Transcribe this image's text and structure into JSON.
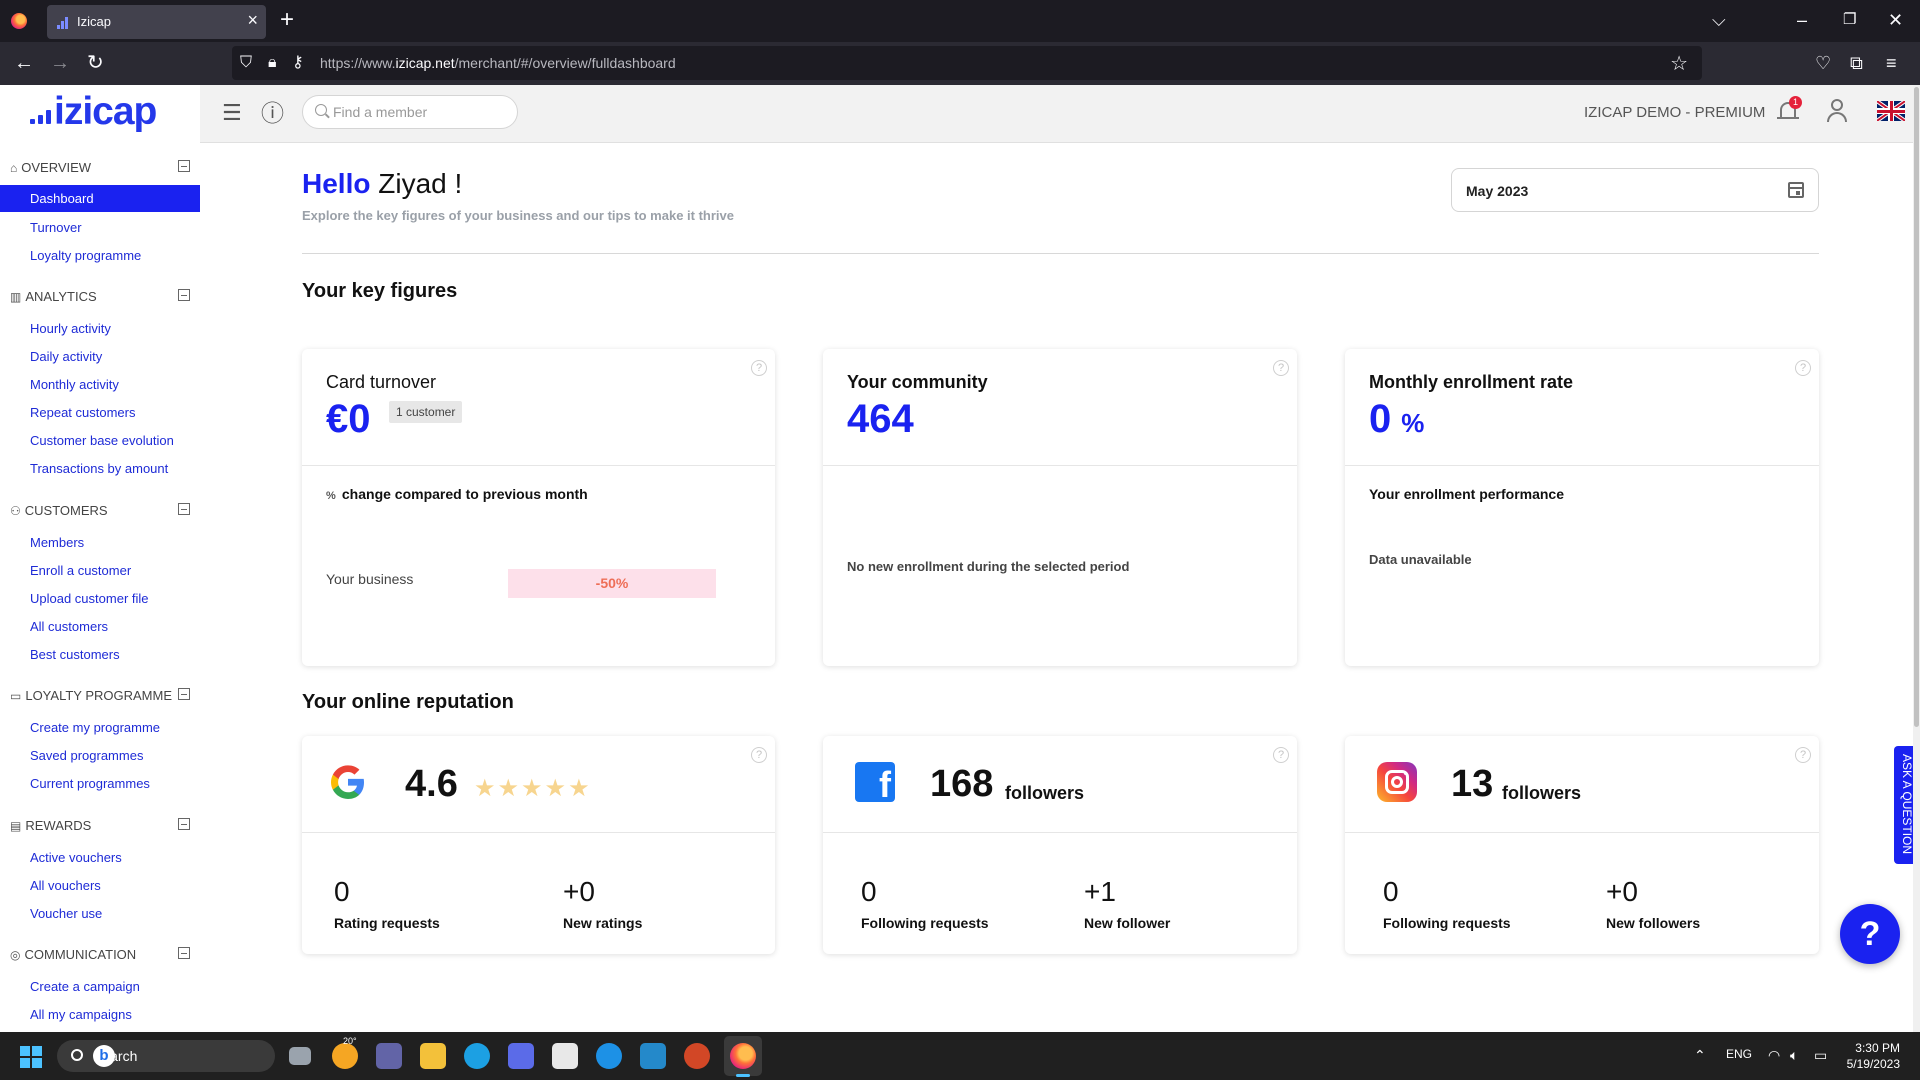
{
  "browser": {
    "tab_title": "Izicap",
    "url_prefix": "https://www.",
    "url_domain": "izicap.net",
    "url_path": "/merchant/#/overview/fulldashboard"
  },
  "header": {
    "logo_text": "izicap",
    "search_placeholder": "Find a member",
    "account_name": "IZICAP DEMO - PREMIUM",
    "notification_count": "1"
  },
  "sidebar": {
    "sections": [
      {
        "title": "OVERVIEW",
        "items": [
          "Dashboard",
          "Turnover",
          "Loyalty programme"
        ]
      },
      {
        "title": "ANALYTICS",
        "items": [
          "Hourly activity",
          "Daily activity",
          "Monthly activity",
          "Repeat customers",
          "Customer base evolution",
          "Transactions by amount"
        ]
      },
      {
        "title": "CUSTOMERS",
        "items": [
          "Members",
          "Enroll a customer",
          "Upload customer file",
          "All customers",
          "Best customers"
        ]
      },
      {
        "title": "LOYALTY PROGRAMME",
        "items": [
          "Create my programme",
          "Saved programmes",
          "Current programmes"
        ]
      },
      {
        "title": "REWARDS",
        "items": [
          "Active vouchers",
          "All vouchers",
          "Voucher use"
        ]
      },
      {
        "title": "COMMUNICATION",
        "items": [
          "Create a campaign",
          "All my campaigns"
        ]
      }
    ]
  },
  "main": {
    "greeting_hello": "Hello",
    "greeting_name": "Ziyad !",
    "subtitle": "Explore the key figures of your business and our tips to make it thrive",
    "date_value": "May 2023",
    "key_figures_title": "Your key figures",
    "online_reputation_title": "Your online reputation"
  },
  "key_figures": {
    "turnover": {
      "title": "Card turnover",
      "value": "€0",
      "pill": "1 customer",
      "change_label": "change compared to previous month",
      "business_label": "Your business",
      "change_value": "-50%"
    },
    "community": {
      "title": "Your community",
      "value": "464",
      "note": "No new enrollment during the selected period"
    },
    "enrollment": {
      "title": "Monthly enrollment rate",
      "value": "0",
      "unit": "%",
      "performance_label": "Your enrollment performance",
      "note": "Data unavailable"
    }
  },
  "reputation": {
    "google": {
      "rating": "4.6",
      "rating_value": 4.6,
      "stars_total": 5,
      "left_value": "0",
      "left_label": "Rating requests",
      "right_value": "+0",
      "right_label": "New ratings"
    },
    "facebook": {
      "followers": "168",
      "unit": "followers",
      "left_value": "0",
      "left_label": "Following requests",
      "right_value": "+1",
      "right_label": "New follower"
    },
    "instagram": {
      "followers": "13",
      "unit": "followers",
      "left_value": "0",
      "left_label": "Following requests",
      "right_value": "+0",
      "right_label": "New followers"
    }
  },
  "floating": {
    "ask_label": "ASK A QUESTION",
    "help_label": "?"
  },
  "taskbar": {
    "search_label": "Search",
    "weather": "20°",
    "language": "ENG",
    "time": "3:30 PM",
    "date": "5/19/2023"
  },
  "colors": {
    "brand_blue": "#1a22f0",
    "trend_negative": "#ee6e57"
  }
}
